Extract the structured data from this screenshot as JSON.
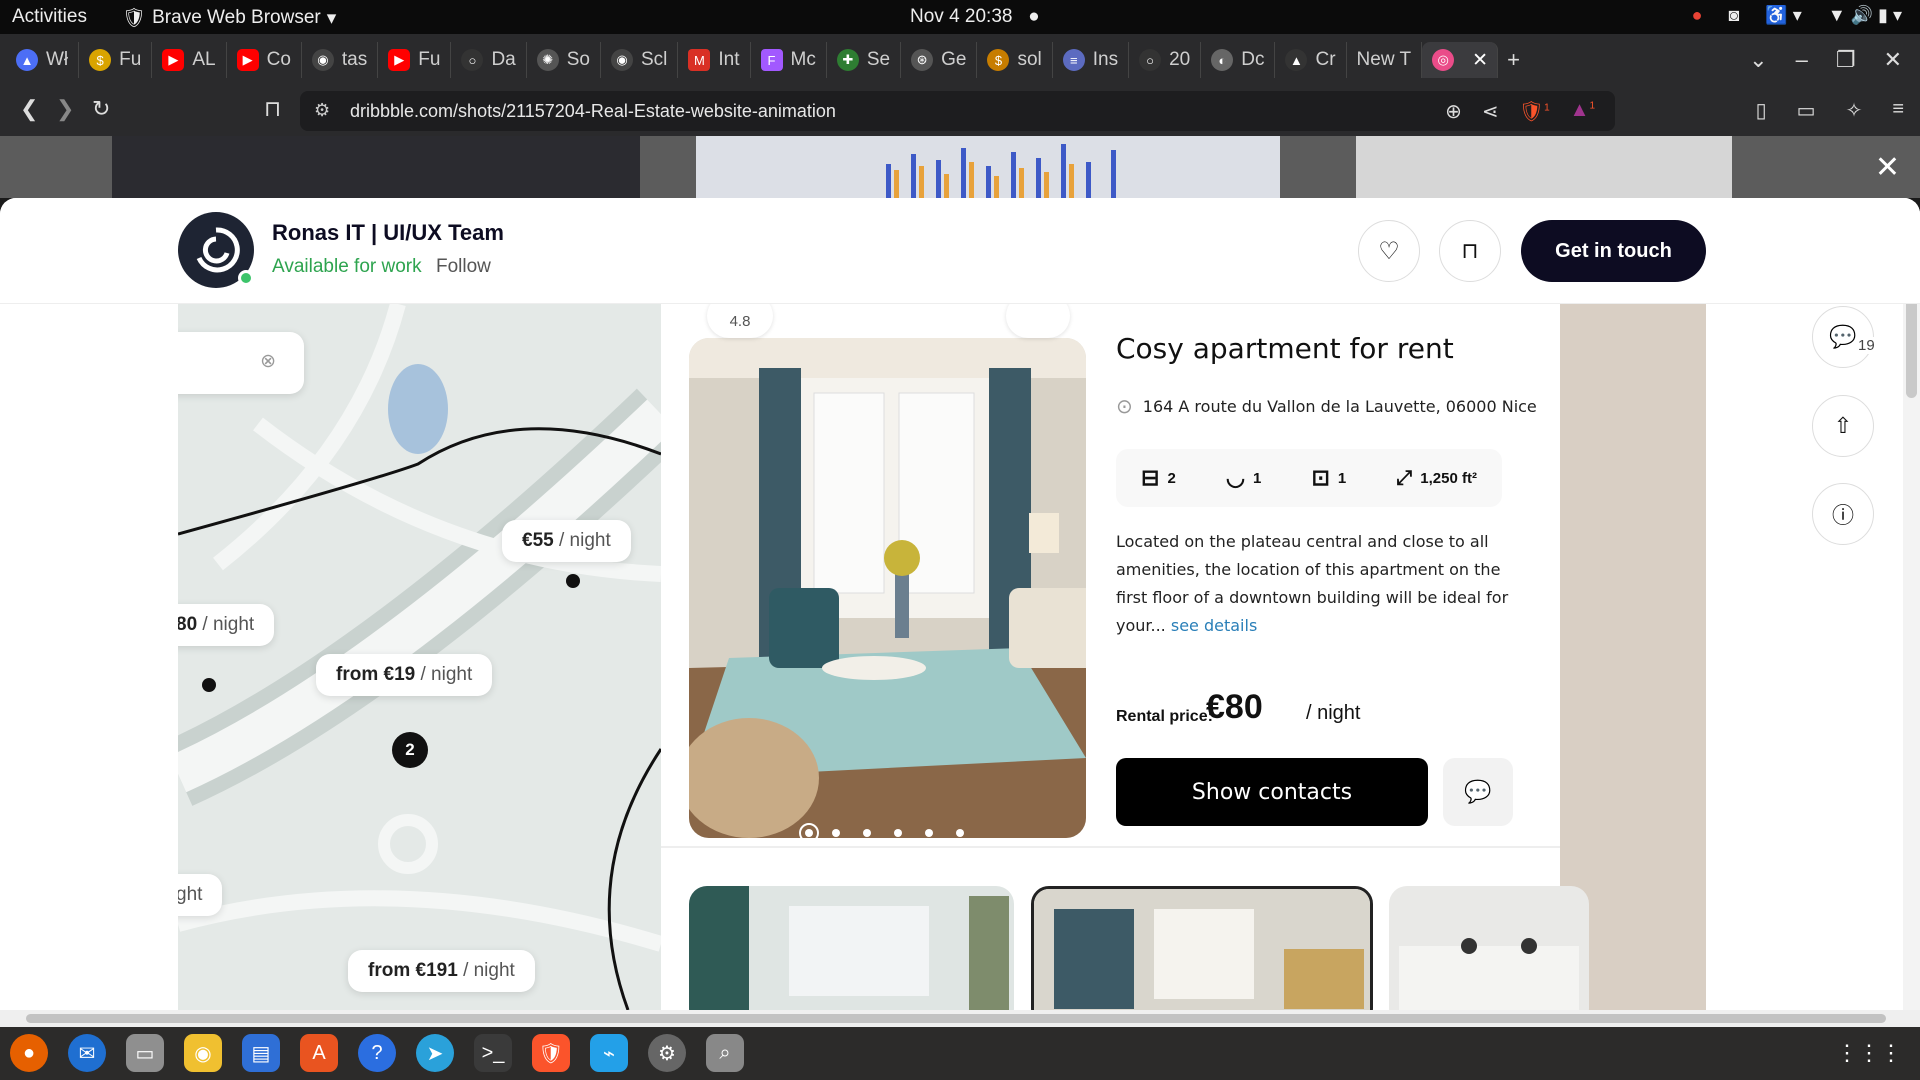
{
  "system": {
    "activities": "Activities",
    "app_name": "Brave Web Browser",
    "clock": "Nov 4  20:38"
  },
  "tabs": [
    {
      "label": "Wł",
      "color": "#4c6ef5"
    },
    {
      "label": "Fu",
      "color": "#d9a400"
    },
    {
      "label": "AL",
      "color": "#ff0000"
    },
    {
      "label": "Co",
      "color": "#ff0000"
    },
    {
      "label": "tas",
      "color": "#444444"
    },
    {
      "label": "Fu",
      "color": "#ff0000"
    },
    {
      "label": "Da",
      "color": "#333333"
    },
    {
      "label": "So",
      "color": "#555555"
    },
    {
      "label": "Scl",
      "color": "#444444"
    },
    {
      "label": "Int",
      "color": "#d93025"
    },
    {
      "label": "Mc",
      "color": "#a259ff"
    },
    {
      "label": "Se",
      "color": "#2e7d32"
    },
    {
      "label": "Ge",
      "color": "#555555"
    },
    {
      "label": "sol",
      "color": "#c77d00"
    },
    {
      "label": "Ins",
      "color": "#5c6bc0"
    },
    {
      "label": "20",
      "color": "#333333"
    },
    {
      "label": "Dc",
      "color": "#666666"
    },
    {
      "label": "Cr",
      "color": "#333333"
    },
    {
      "label": "New T",
      "color": ""
    },
    {
      "label": "",
      "color": "#ea4c89"
    }
  ],
  "address": {
    "url": "dribbble.com/shots/21157204-Real-Estate-website-animation",
    "brave_badge": "1",
    "rewards_badge": "1"
  },
  "header": {
    "author": "Ronas IT | UI/UX Team",
    "availability": "Available for work",
    "follow": "Follow",
    "cta": "Get in touch"
  },
  "sidebar": {
    "comments_count": "19"
  },
  "map": {
    "cards": [
      {
        "price": "€55",
        "unit": "/ night"
      },
      {
        "price": "80",
        "unit": "/ night"
      },
      {
        "price": "from €19",
        "unit": "/ night"
      },
      {
        "price": "",
        "unit": "ght"
      },
      {
        "price": "from €191",
        "unit": "/ night"
      }
    ],
    "cluster_count": "2"
  },
  "listing": {
    "rating": "4.8",
    "title": "Cosy apartment for rent",
    "address": "164 A route du Vallon de la Lauvette, 06000 Nice",
    "features": {
      "beds": "2",
      "baths": "1",
      "parking": "1",
      "area": "1,250 ft²"
    },
    "description": "Located on the plateau central and close to all amenities, the location of this apartment  on the first floor of a downtown building will be ideal for your...",
    "see_details": "see details",
    "price_label": "Rental price:",
    "price": "€80",
    "price_unit": "/ night",
    "show_contacts": "Show contacts"
  }
}
